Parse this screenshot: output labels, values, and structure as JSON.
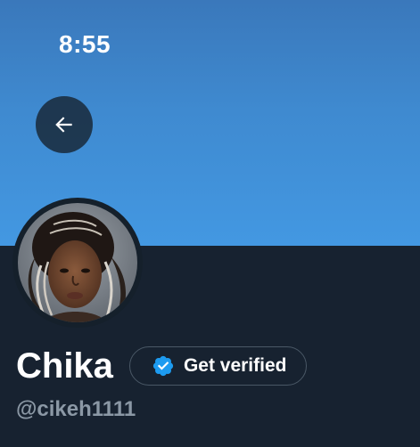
{
  "status_bar": {
    "time": "8:55"
  },
  "navigation": {
    "back_icon": "arrow-left-icon"
  },
  "profile": {
    "display_name": "Chika",
    "handle": "@cikeh1111",
    "avatar_description": "profile photo"
  },
  "verification": {
    "label": "Get verified",
    "icon": "verified-badge-icon"
  },
  "colors": {
    "banner_top": "#3a78bb",
    "banner_bottom": "#4398e2",
    "background": "#172230",
    "verified_blue": "#1d9bf0",
    "muted_text": "#8b98a5"
  }
}
